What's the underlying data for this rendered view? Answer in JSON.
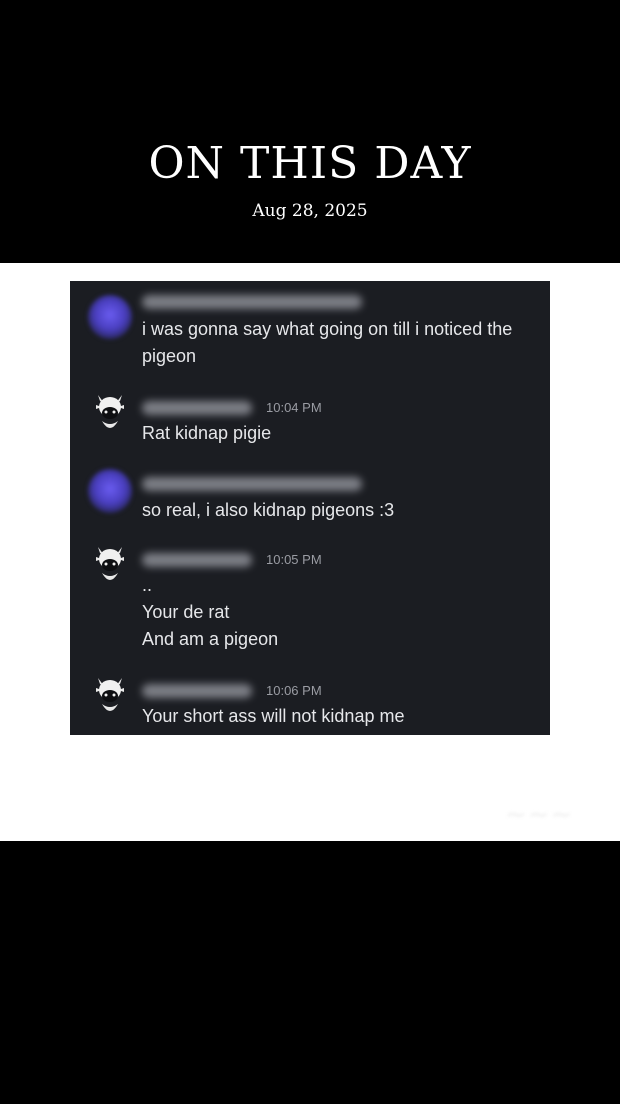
{
  "header": {
    "title": "ON THIS DAY",
    "date": "Aug 28, 2025"
  },
  "chat": {
    "messages": [
      {
        "author_avatar": "blurred-purple-avatar",
        "time": "",
        "lines": [
          "i was gonna say what going on till i noticed the",
          "pigeon"
        ]
      },
      {
        "author_avatar": "white-pigeon-avatar",
        "time": "10:04 PM",
        "lines": [
          "Rat kidnap pigie"
        ]
      },
      {
        "author_avatar": "blurred-purple-avatar",
        "time": "",
        "lines": [
          "so real, i also kidnap pigeons :3"
        ]
      },
      {
        "author_avatar": "white-pigeon-avatar",
        "time": "10:05 PM",
        "lines": [
          "..",
          "Your de rat",
          "And am a pigeon"
        ]
      },
      {
        "author_avatar": "white-pigeon-avatar",
        "time": "10:06 PM",
        "lines": [
          "Your short ass will not kidnap me"
        ]
      }
    ]
  },
  "colors": {
    "background": "#000000",
    "band": "#ffffff",
    "chat_bg": "#1b1d22",
    "text": "#e6e7ea",
    "timestamp": "#9a9ca3"
  }
}
